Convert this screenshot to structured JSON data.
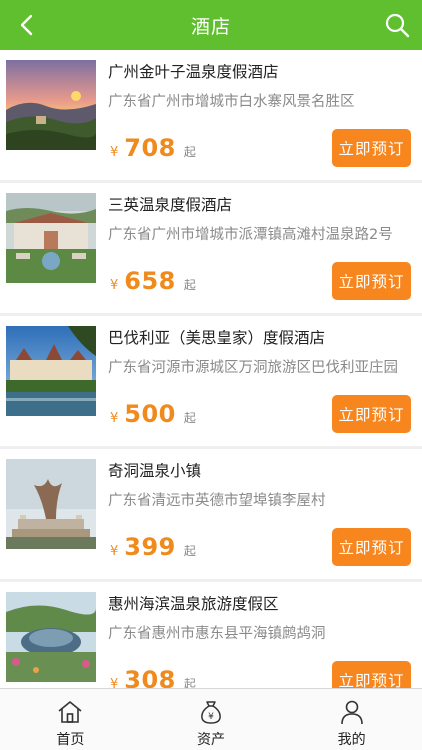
{
  "header": {
    "title": "酒店",
    "back_icon": "chevron-left-icon",
    "search_icon": "search-icon"
  },
  "colors": {
    "header_bg": "#5fbf2f",
    "accent": "#f7861f",
    "price": "#f08a1c"
  },
  "hotels": [
    {
      "name": "广州金叶子温泉度假酒店",
      "address": "广东省广州市增城市白水寨风景名胜区",
      "currency": "¥",
      "price": "708",
      "price_suffix": "起",
      "button": "立即预订"
    },
    {
      "name": "三英温泉度假酒店",
      "address": "广东省广州市增城市派潭镇高滩村温泉路2号",
      "currency": "¥",
      "price": "658",
      "price_suffix": "起",
      "button": "立即预订"
    },
    {
      "name": "巴伐利亚（美思皇家）度假酒店",
      "address": "广东省河源市源城区万洞旅游区巴伐利亚庄园",
      "currency": "¥",
      "price": "500",
      "price_suffix": "起",
      "button": "立即预订"
    },
    {
      "name": "奇洞温泉小镇",
      "address": "广东省清远市英德市望埠镇李屋村",
      "currency": "¥",
      "price": "399",
      "price_suffix": "起",
      "button": "立即预订"
    },
    {
      "name": "惠州海滨温泉旅游度假区",
      "address": "广东省惠州市惠东县平海镇鹧鸪洞",
      "currency": "¥",
      "price": "308",
      "price_suffix": "起",
      "button": "立即预订"
    }
  ],
  "tabbar": [
    {
      "label": "首页",
      "icon": "home-icon"
    },
    {
      "label": "资产",
      "icon": "money-bag-icon"
    },
    {
      "label": "我的",
      "icon": "user-icon"
    }
  ]
}
